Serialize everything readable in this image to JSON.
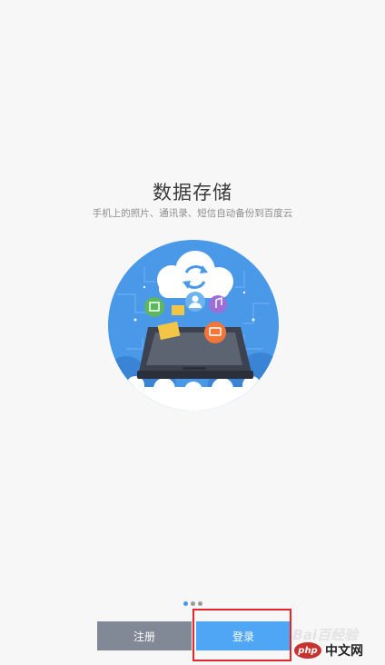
{
  "intro": {
    "title": "数据存储",
    "subtitle": "手机上的照片、通讯录、短信自动备份到百度云"
  },
  "illustration": {
    "icons": [
      "sync-icon",
      "contact-icon",
      "music-icon",
      "photo-icon",
      "message-icon",
      "folder-icon"
    ],
    "accent": "#4a98e8"
  },
  "pager": {
    "count": 3,
    "active": 0
  },
  "actions": {
    "register_label": "注册",
    "login_label": "登录"
  },
  "watermark": {
    "text": "Bai百经验",
    "logo_php": "php",
    "logo_cn": "中文网"
  }
}
